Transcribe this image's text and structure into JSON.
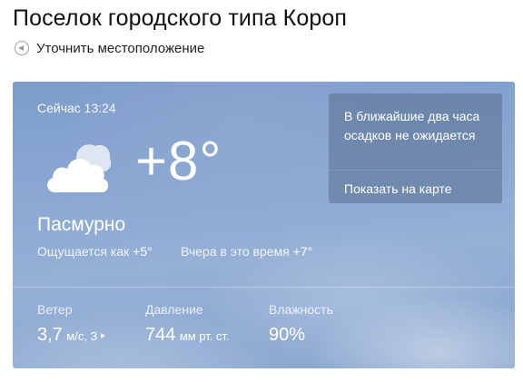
{
  "header": {
    "title": "Поселок городского типа Короп",
    "locate_label": "Уточнить местоположение"
  },
  "now": {
    "time_label": "Сейчас 13:24",
    "icon": "overcast-cloud-icon",
    "temperature": "+8°",
    "condition": "Пасмурно",
    "feels_like_label": "Ощущается как",
    "feels_like_value": "+5°",
    "yesterday_label": "Вчера в это время",
    "yesterday_value": "+7°"
  },
  "precip": {
    "text": "В ближайшие два часа осадков не ожидается",
    "map_link": "Показать на карте"
  },
  "stats": {
    "wind": {
      "label": "Ветер",
      "value": "3,7",
      "unit": "м/с, З"
    },
    "pressure": {
      "label": "Давление",
      "value": "744",
      "unit": "мм рт. ст."
    },
    "humidity": {
      "label": "Влажность",
      "value": "90%"
    }
  },
  "colors": {
    "card_sky": "#8aa8d2",
    "precip_panel": "#607696",
    "text_on_card": "#ffffff"
  }
}
